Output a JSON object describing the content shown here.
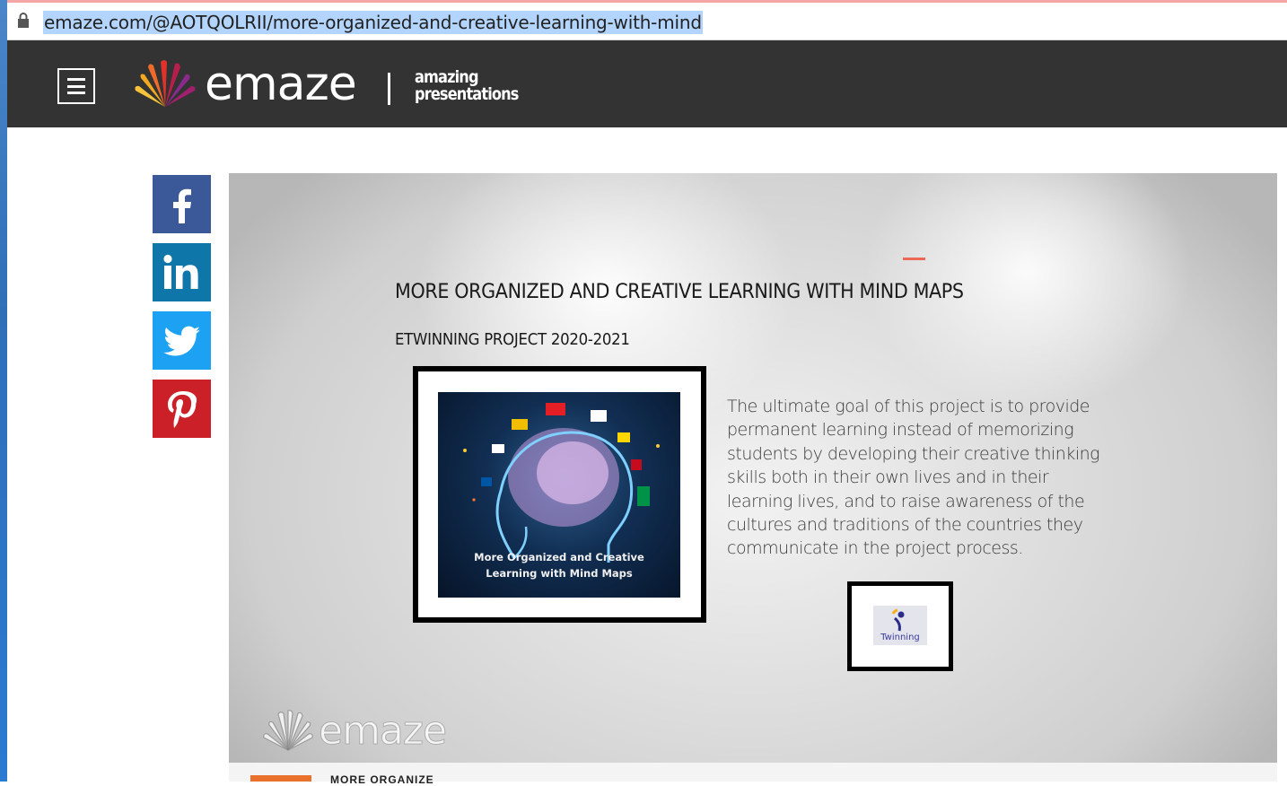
{
  "browser": {
    "url": "emaze.com/@AOTQOLRII/more-organized-and-creative-learning-with-mind",
    "lock_icon": "lock-icon"
  },
  "header": {
    "menu_icon": "hamburger-menu-icon",
    "logo_text": "emaze",
    "tagline_line1": "amazing",
    "tagline_line2": "presentations",
    "background": "#333333"
  },
  "share": [
    {
      "name": "facebook",
      "icon": "facebook-icon",
      "color": "#3b5998"
    },
    {
      "name": "linkedin",
      "icon": "linkedin-icon",
      "color": "#0e76a8"
    },
    {
      "name": "twitter",
      "icon": "twitter-icon",
      "color": "#1da1f2"
    },
    {
      "name": "pinterest",
      "icon": "pinterest-icon",
      "color": "#cb2027"
    }
  ],
  "slide": {
    "title": "MORE ORGANIZED AND CREATIVE LEARNING WITH MIND MAPS",
    "subtitle": "ETWINNING PROJECT 2020-2021",
    "image_caption_line1": "More Organized and Creative",
    "image_caption_line2": "Learning with Mind Maps",
    "body": "The ultimate goal of this project is to provide permanent learning instead of memorizing students by developing their creative thinking skills both in their own lives and in their learning lives, and to raise awareness of the cultures and traditions of the countries they communicate in the project process.",
    "badge_label": "Twinning",
    "watermark": "emaze",
    "accent_color": "#ec6a55"
  },
  "next_slide": {
    "thumbnail_text": "MORE ORGANIZE"
  }
}
